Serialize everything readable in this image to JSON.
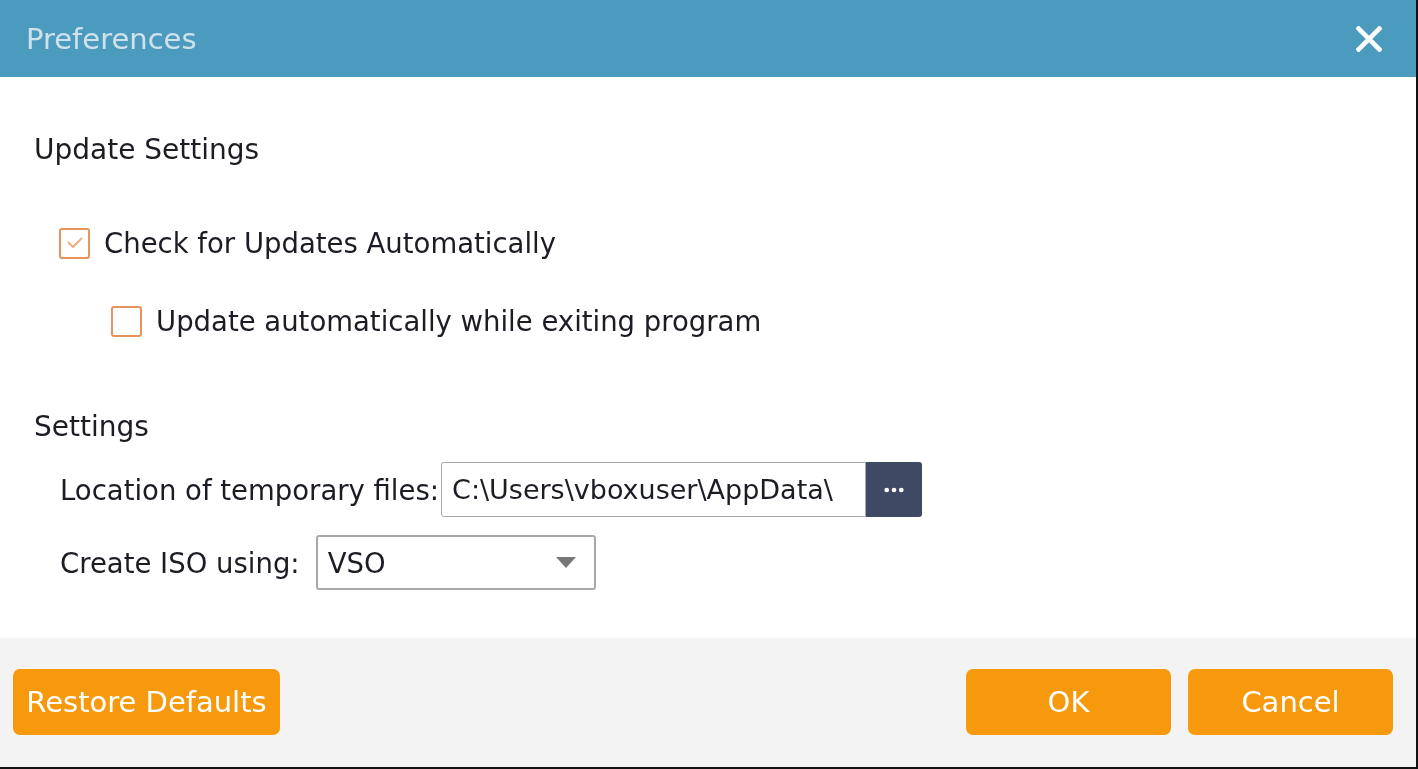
{
  "window": {
    "title": "Preferences"
  },
  "update_settings": {
    "heading": "Update Settings",
    "options": [
      {
        "label": "Check for Updates Automatically",
        "checked": true,
        "children": [
          {
            "label": "Update automatically while exiting program",
            "checked": false
          }
        ]
      }
    ]
  },
  "settings": {
    "heading": "Settings",
    "temp_location": {
      "label": "Location of temporary files:",
      "value": "C:\\Users\\vboxuser\\AppData\\"
    },
    "create_iso": {
      "label": "Create ISO using:",
      "value": "VSO"
    }
  },
  "footer": {
    "restore_button": "Restore Defaults",
    "buttons": [
      "OK",
      "Cancel"
    ]
  }
}
